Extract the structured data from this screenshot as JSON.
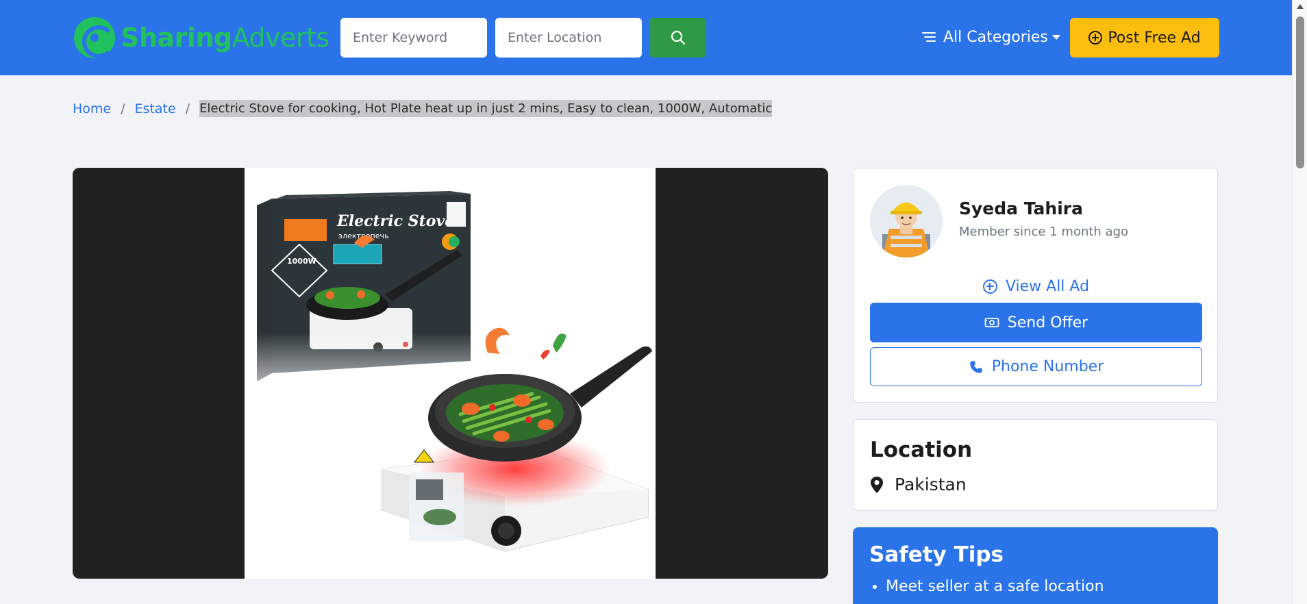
{
  "header": {
    "logo_bold": "Sharing",
    "logo_rest": "Adverts",
    "keyword_placeholder": "Enter Keyword",
    "location_placeholder": "Enter Location",
    "categories_label": "All Categories",
    "post_ad_label": "Post Free Ad"
  },
  "breadcrumb": {
    "home": "Home",
    "category": "Estate",
    "current": "Electric Stove for cooking, Hot Plate heat up in just 2 mins, Easy to clean, 1000W, Automatic"
  },
  "product_image": {
    "box_title": "Electric Stove",
    "box_subtitle": "электропечь",
    "power_badge": "1000W"
  },
  "seller": {
    "name": "Syeda Tahira",
    "member_since": "Member since 1 month ago",
    "view_all_label": "View All Ad",
    "send_offer_label": "Send Offer",
    "phone_label": "Phone Number"
  },
  "location": {
    "title": "Location",
    "value": "Pakistan"
  },
  "safety": {
    "title": "Safety Tips",
    "tips": [
      "Meet seller at a safe location"
    ]
  },
  "colors": {
    "primary": "#2a73e8",
    "brand_green": "#21c25e",
    "search_green": "#2f9a45",
    "post_yellow": "#fbbe0f"
  }
}
